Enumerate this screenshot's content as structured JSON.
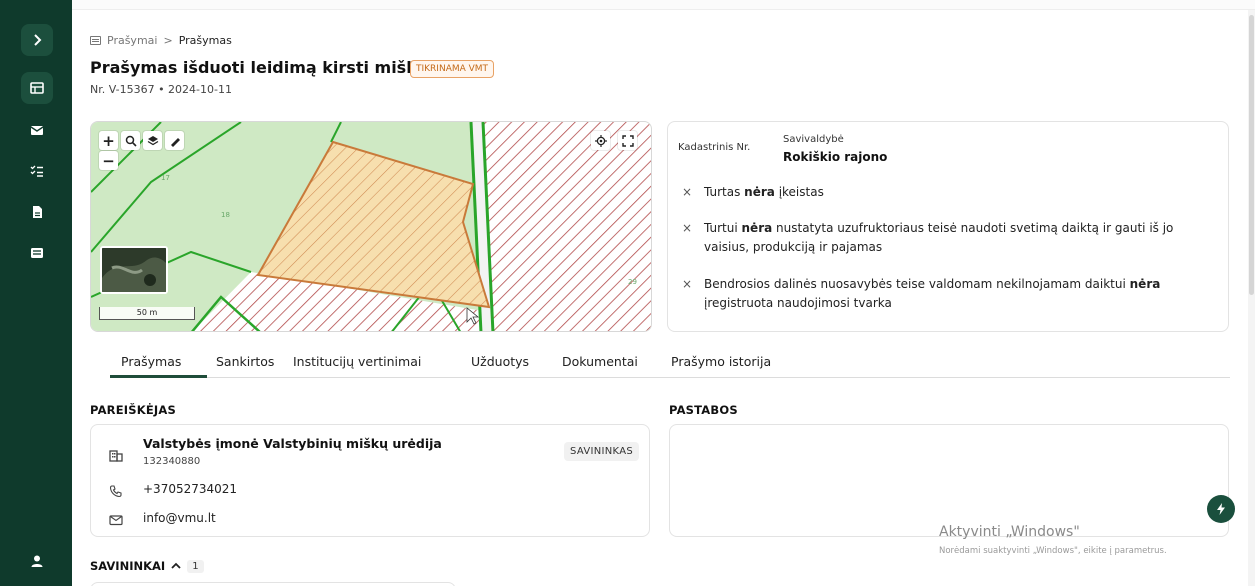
{
  "breadcrumb": {
    "root": "Prašymai",
    "separator": ">",
    "current": "Prašymas"
  },
  "page": {
    "title": "Prašymas išduoti leidimą kirsti mišką",
    "status": "TIKRINAMA VMT",
    "subtitle": "Nr. V-15367 • 2024-10-11"
  },
  "sidebar": {
    "items": [
      {
        "icon": "chevron-right-icon"
      },
      {
        "icon": "table-icon"
      },
      {
        "icon": "mail-icon"
      },
      {
        "icon": "checklist-icon"
      },
      {
        "icon": "document-icon"
      },
      {
        "icon": "id-card-icon"
      },
      {
        "icon": "user-icon"
      }
    ]
  },
  "map": {
    "scale": "50 m",
    "parcel_numbers": [
      "17",
      "18",
      "29"
    ],
    "controls": [
      "plus-icon",
      "minus-icon",
      "search-icon",
      "layers-icon",
      "ruler-icon",
      "locate-icon",
      "fullscreen-icon"
    ]
  },
  "info": {
    "cadastral_label": "Kadastrinis Nr.",
    "municipality_label": "Savivaldybė",
    "municipality_value": "Rokiškio rajono",
    "facts": [
      {
        "pre": "Turtas ",
        "bold": "nėra",
        "post": " įkeistas"
      },
      {
        "pre": "Turtui ",
        "bold": "nėra",
        "post": " nustatyta uzufruktoriaus teisė naudoti svetimą daiktą ir gauti iš jo vaisius, produkciją ir pajamas"
      },
      {
        "pre": "Bendrosios dalinės nuosavybės teise valdomam nekilnojamam daiktui ",
        "bold": "nėra",
        "post": " įregistruota naudojimosi tvarka"
      }
    ]
  },
  "tabs": [
    "Prašymas",
    "Sankirtos",
    "Institucijų vertinimai",
    "Užduotys",
    "Dokumentai",
    "Prašymo istorija"
  ],
  "applicant": {
    "heading": "PAREIŠKĖJAS",
    "name": "Valstybės įmonė Valstybinių miškų urėdija",
    "code": "132340880",
    "role": "SAVININKAS",
    "phone": "+37052734021",
    "email": "info@vmu.lt"
  },
  "notes": {
    "heading": "PASTABOS"
  },
  "owners": {
    "heading": "SAVININKAI",
    "count": "1"
  },
  "windows_notice": {
    "title": "Aktyvinti „Windows\"",
    "subtitle": "Norėdami suaktyvinti „Windows\", eikite į parametrus."
  },
  "colors": {
    "sidebar": "#0f3a2c",
    "accent": "#1f4d3a",
    "badge": "#c46a18",
    "parcel_fill": "#f7dfae",
    "parcel_stroke": "#c97a3a",
    "hatch": "#b24a4a",
    "map_green": "#cfe9c4"
  }
}
